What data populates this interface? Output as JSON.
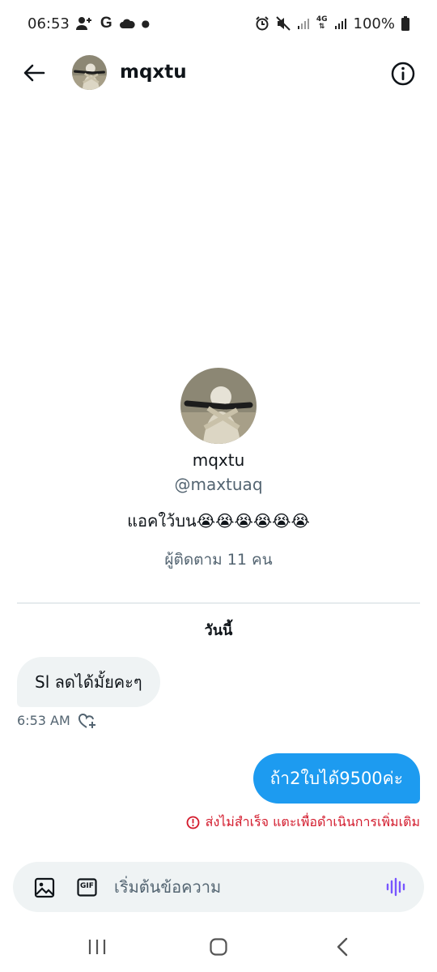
{
  "status_bar": {
    "time": "06:53",
    "g_label": "G",
    "network_label": "4G",
    "battery": "100%"
  },
  "header": {
    "name": "mqxtu"
  },
  "profile": {
    "name": "mqxtu",
    "handle": "@maxtuaq",
    "bio": "แอคใว้บน😭😭😭😭😭😭",
    "followers": "ผู้ติดตาม 11 คน"
  },
  "conversation": {
    "date_label": "วันนี้",
    "messages": [
      {
        "direction": "in",
        "text": "Sl ลดได้มั้ยคะๆ",
        "time": "6:53 AM"
      },
      {
        "direction": "out",
        "text": "ถ้า2ใบได้9500ค่ะ",
        "error": "ส่งไม่สำเร็จ แตะเพื่อดำเนินการเพิ่มเติม"
      }
    ]
  },
  "composer": {
    "placeholder": "เริ่มต้นข้อความ",
    "gif_label": "GIF"
  },
  "colors": {
    "accent": "#1d9bf0",
    "bubble_in": "#eff3f4",
    "error": "#d31a2c",
    "voice": "#7856ff"
  },
  "icons": [
    "person-add-icon",
    "cloud-icon",
    "alarm-icon",
    "mute-icon",
    "signal-icon",
    "battery-icon",
    "back-arrow-icon",
    "info-icon",
    "add-reaction-icon",
    "error-icon",
    "image-icon",
    "gif-icon",
    "voice-icon",
    "recent-apps-icon",
    "home-icon",
    "nav-back-icon"
  ]
}
